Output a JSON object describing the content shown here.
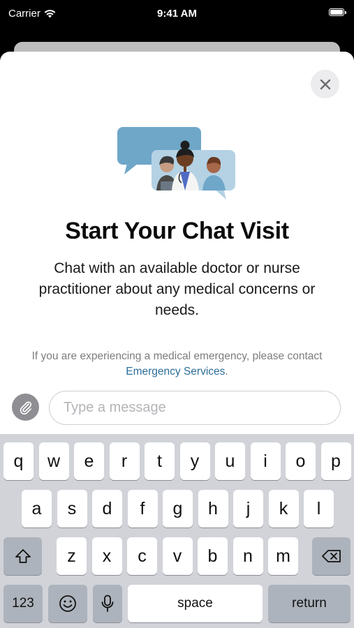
{
  "status_bar": {
    "carrier": "Carrier",
    "time": "9:41 AM"
  },
  "sheet": {
    "title": "Start Your Chat Visit",
    "subtitle": "Chat with an available doctor or nurse practitioner about any medical concerns or needs.",
    "emergency_text": "If you are experiencing a medical emergency, please contact ",
    "emergency_link": "Emergency Services",
    "emergency_end": "."
  },
  "composer": {
    "placeholder": "Type a message",
    "value": ""
  },
  "keyboard": {
    "row1": [
      "q",
      "w",
      "e",
      "r",
      "t",
      "y",
      "u",
      "i",
      "o",
      "p"
    ],
    "row2": [
      "a",
      "s",
      "d",
      "f",
      "g",
      "h",
      "j",
      "k",
      "l"
    ],
    "row3": [
      "z",
      "x",
      "c",
      "v",
      "b",
      "n",
      "m"
    ],
    "numbers_label": "123",
    "space_label": "space",
    "return_label": "return"
  },
  "icons": [
    "wifi-icon",
    "battery-icon",
    "close-icon",
    "chat-illustration",
    "paperclip-icon",
    "shift-icon",
    "backspace-icon",
    "emoji-icon",
    "microphone-icon"
  ],
  "colors": {
    "link": "#2c6e98",
    "keyboard_bg": "#d1d3d9",
    "chat_bubble": "#6fa7c9"
  }
}
